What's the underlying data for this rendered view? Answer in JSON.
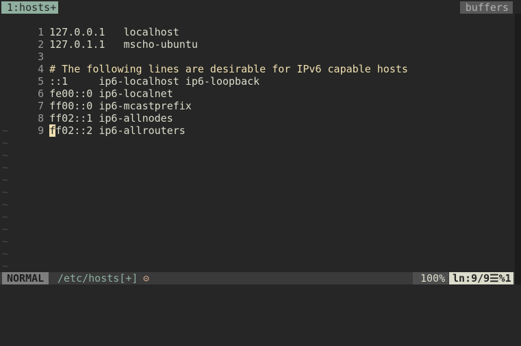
{
  "tabline": {
    "active_tab": "1:hosts+",
    "right_label": "buffers"
  },
  "editor": {
    "lines": [
      {
        "num": "1",
        "text": "127.0.0.1   localhost"
      },
      {
        "num": "2",
        "text": "127.0.1.1   mscho-ubuntu"
      },
      {
        "num": "3",
        "text": ""
      },
      {
        "num": "4",
        "text": "# The following lines are desirable for IPv6 capable hosts"
      },
      {
        "num": "5",
        "text": "::1     ip6-localhost ip6-loopback"
      },
      {
        "num": "6",
        "text": "fe00::0 ip6-localnet"
      },
      {
        "num": "7",
        "text": "ff00::0 ip6-mcastprefix"
      },
      {
        "num": "8",
        "text": "ff02::1 ip6-allnodes"
      },
      {
        "num": "9",
        "cursor_char": "f",
        "text_after_cursor": "f02::2 ip6-allrouters"
      }
    ],
    "tilde": "~"
  },
  "statusline": {
    "mode": "NORMAL",
    "filename": "/etc/hosts[+]",
    "warning_icon": "⊝",
    "percent": "100%",
    "position": "ln:9/9☰%1"
  },
  "colors": {
    "background": "#262626",
    "active_tab": "#8faf9f",
    "comment": "#f0dfaf",
    "cursor": "#f0dfaf",
    "mode_bg": "#7e7e7e"
  }
}
